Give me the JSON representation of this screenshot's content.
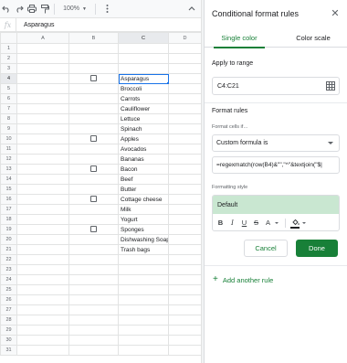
{
  "toolbar": {
    "undo_icon": "undo-icon",
    "redo_icon": "redo-icon",
    "print_icon": "print-icon",
    "paint_format_icon": "paint-format-icon",
    "zoom_label": "100%",
    "more_icon": "more-vert-icon",
    "collapse_icon": "chevron-up-icon"
  },
  "formula_bar": {
    "fx_label": "fx",
    "value": "Asparagus"
  },
  "sheet": {
    "columns": [
      "A",
      "B",
      "C",
      "D"
    ],
    "rows": [
      {
        "n": "1",
        "check": false,
        "c": ""
      },
      {
        "n": "2",
        "check": false,
        "c": ""
      },
      {
        "n": "3",
        "check": false,
        "c": ""
      },
      {
        "n": "4",
        "check": true,
        "c": "Asparagus"
      },
      {
        "n": "5",
        "check": false,
        "c": "Broccoli"
      },
      {
        "n": "6",
        "check": false,
        "c": "Carrots"
      },
      {
        "n": "7",
        "check": false,
        "c": "Cauliflower"
      },
      {
        "n": "8",
        "check": false,
        "c": "Lettuce"
      },
      {
        "n": "9",
        "check": false,
        "c": "Spinach"
      },
      {
        "n": "10",
        "check": true,
        "c": "Apples"
      },
      {
        "n": "11",
        "check": false,
        "c": "Avocados"
      },
      {
        "n": "12",
        "check": false,
        "c": "Bananas"
      },
      {
        "n": "13",
        "check": true,
        "c": "Bacon"
      },
      {
        "n": "14",
        "check": false,
        "c": "Beef"
      },
      {
        "n": "15",
        "check": false,
        "c": "Butter"
      },
      {
        "n": "16",
        "check": true,
        "c": "Cottage cheese"
      },
      {
        "n": "17",
        "check": false,
        "c": "Milk"
      },
      {
        "n": "18",
        "check": false,
        "c": "Yogurt"
      },
      {
        "n": "19",
        "check": true,
        "c": "Sponges"
      },
      {
        "n": "20",
        "check": false,
        "c": "Dishwashing Soap"
      },
      {
        "n": "21",
        "check": false,
        "c": "Trash bags"
      },
      {
        "n": "22",
        "check": false,
        "c": ""
      },
      {
        "n": "23",
        "check": false,
        "c": ""
      },
      {
        "n": "24",
        "check": false,
        "c": ""
      },
      {
        "n": "25",
        "check": false,
        "c": ""
      },
      {
        "n": "26",
        "check": false,
        "c": ""
      },
      {
        "n": "27",
        "check": false,
        "c": ""
      },
      {
        "n": "28",
        "check": false,
        "c": ""
      },
      {
        "n": "29",
        "check": false,
        "c": ""
      },
      {
        "n": "30",
        "check": false,
        "c": ""
      },
      {
        "n": "31",
        "check": false,
        "c": ""
      }
    ],
    "selected_cell": "C4"
  },
  "panel": {
    "title": "Conditional format rules",
    "close_icon": "close-icon",
    "tabs": {
      "single_color": "Single color",
      "color_scale": "Color scale"
    },
    "apply_to_range_label": "Apply to range",
    "range_value": "C4:C21",
    "range_icon": "select-range-icon",
    "format_rules_label": "Format rules",
    "format_cells_if_label": "Format cells if…",
    "condition_value": "Custom formula is",
    "formula_value": "=regexmatch(row(B4)&\"\",\"^\"&textjoin(\"$|",
    "formatting_style_label": "Formatting style",
    "style_preview": "Default",
    "style_preview_color": "#c9e7d1",
    "style_tools": [
      "B",
      "I",
      "U",
      "S",
      "A"
    ],
    "cancel_label": "Cancel",
    "done_label": "Done",
    "add_rule_label": "Add another rule",
    "accent_color": "#188038"
  }
}
